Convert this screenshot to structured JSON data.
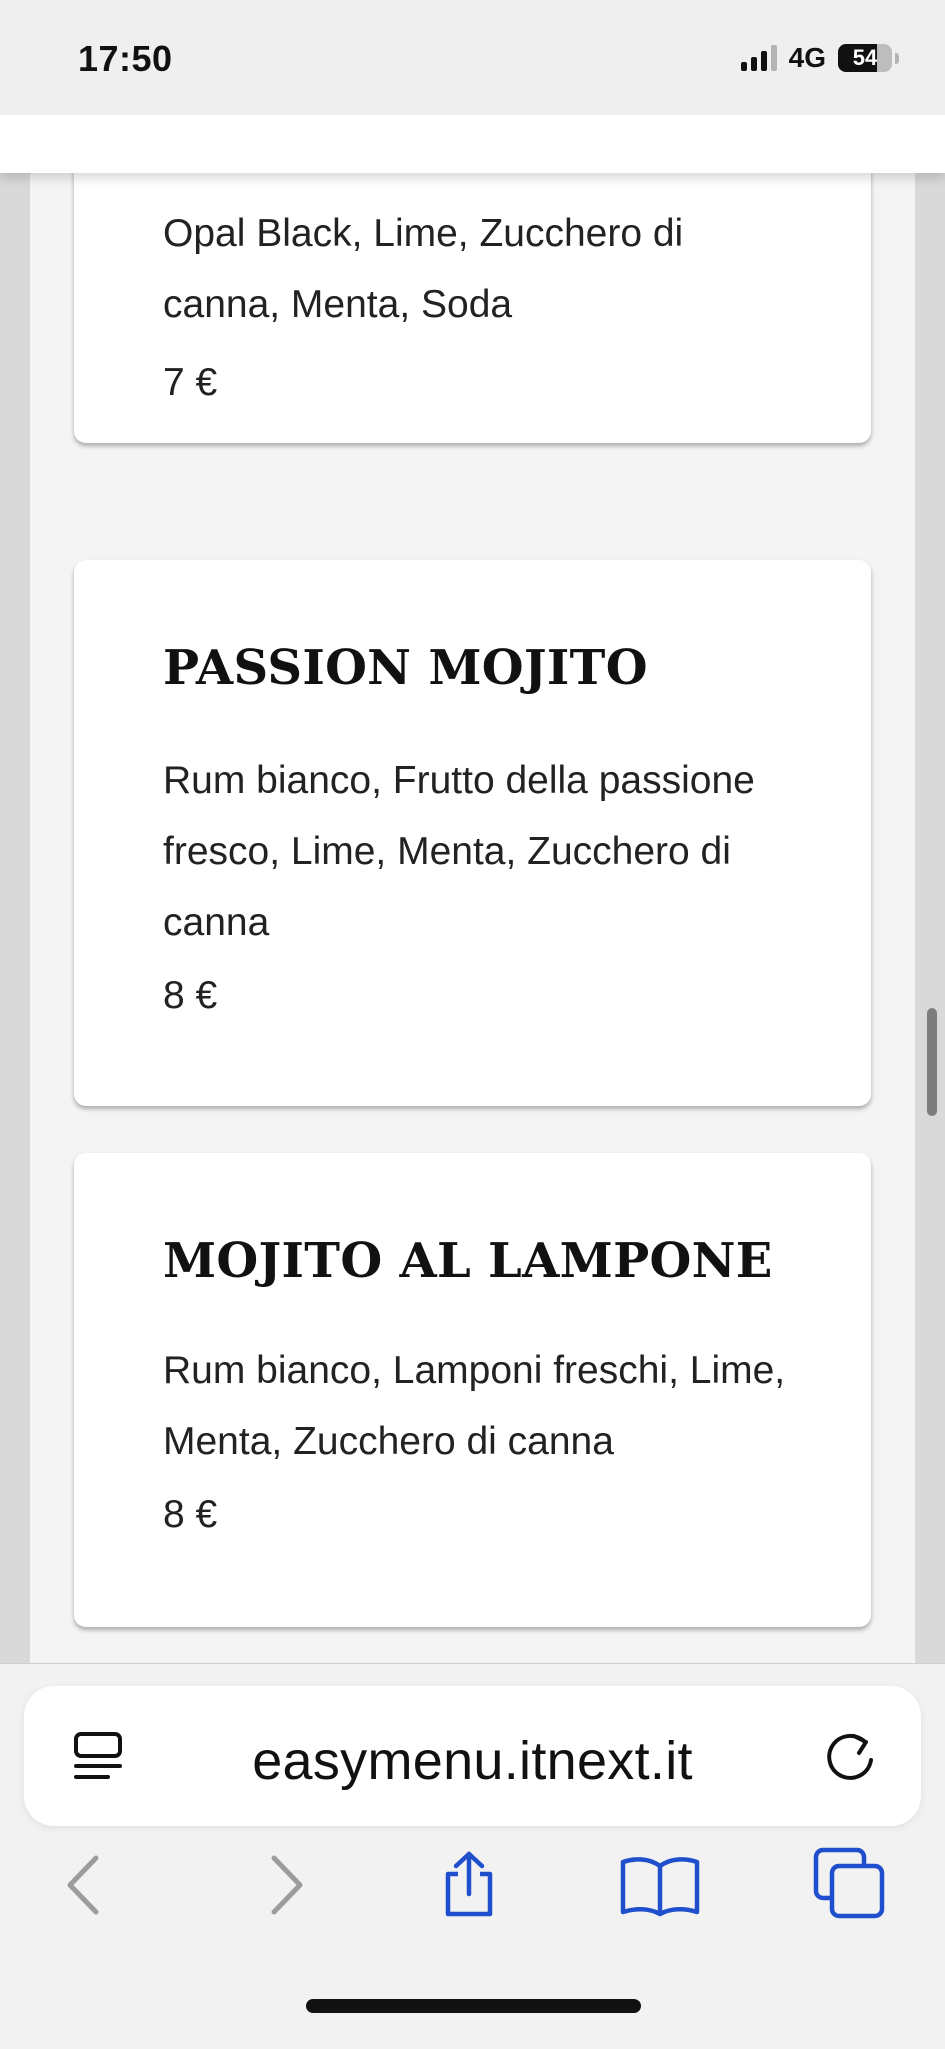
{
  "status_bar": {
    "time": "17:50",
    "network": "4G",
    "battery_level": "54"
  },
  "menu": {
    "items": [
      {
        "name": "",
        "ingredients": "Opal Black, Lime, Zucchero di canna, Menta, Soda",
        "price": "7 €"
      },
      {
        "name": "PASSION MOJITO",
        "ingredients": "Rum bianco, Frutto della passione fresco, Lime, Menta, Zucchero di canna",
        "price": "8 €"
      },
      {
        "name": "MOJITO AL LAMPONE",
        "ingredients": "Rum bianco, Lamponi freschi, Lime, Menta, Zucchero di canna",
        "price": "8 €"
      }
    ]
  },
  "browser": {
    "url": "easymenu.itnext.it",
    "accent_color": "#1f4fcc",
    "icons": {
      "reader": "reader-icon",
      "reload": "reload-icon",
      "back": "back-icon",
      "forward": "forward-icon",
      "share": "share-icon",
      "bookmarks": "bookmarks-icon",
      "tabs": "tabs-icon"
    }
  }
}
